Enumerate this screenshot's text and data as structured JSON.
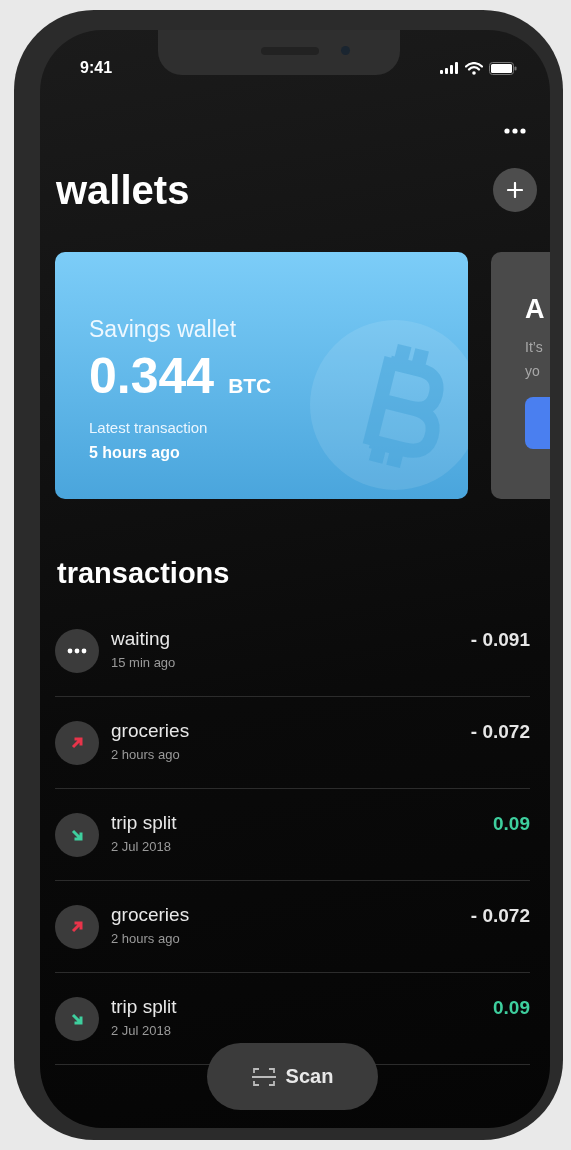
{
  "status_bar": {
    "time": "9:41"
  },
  "title": "wallets",
  "wallets": [
    {
      "kind": "wallet",
      "name": "Savings wallet",
      "amount": "0.344",
      "unit": "BTC",
      "latest_label": "Latest transaction",
      "latest_time": "5 hours ago"
    },
    {
      "kind": "promo",
      "title": "A",
      "lines": [
        "It’s",
        "yo"
      ]
    }
  ],
  "transactions_title": "transactions",
  "transactions": [
    {
      "kind": "pending",
      "name": "waiting",
      "time": "15 min ago",
      "amount": "- 0.091"
    },
    {
      "kind": "out",
      "name": "groceries",
      "time": "2 hours ago",
      "amount": "- 0.072"
    },
    {
      "kind": "in",
      "name": "trip split",
      "time": "2 Jul 2018",
      "amount": "0.09"
    },
    {
      "kind": "out",
      "name": "groceries",
      "time": "2 hours ago",
      "amount": "- 0.072"
    },
    {
      "kind": "in",
      "name": "trip split",
      "time": "2 Jul 2018",
      "amount": "0.09"
    }
  ],
  "scan_button": {
    "label": "Scan"
  }
}
